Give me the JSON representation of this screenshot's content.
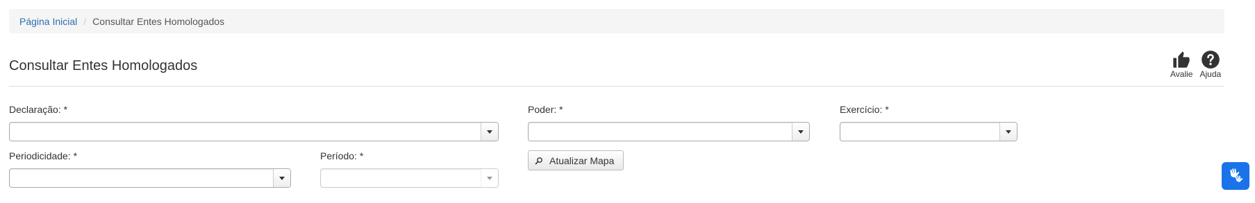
{
  "breadcrumb": {
    "home": "Página Inicial",
    "current": "Consultar Entes Homologados"
  },
  "page": {
    "title": "Consultar Entes Homologados"
  },
  "actions": {
    "rate": "Avalie",
    "help": "Ajuda"
  },
  "form": {
    "declaracao": {
      "label": "Declaração: *",
      "value": ""
    },
    "poder": {
      "label": "Poder: *",
      "value": ""
    },
    "exercicio": {
      "label": "Exercício: *",
      "value": ""
    },
    "periodicidade": {
      "label": "Periodicidade: *",
      "value": ""
    },
    "periodo": {
      "label": "Período: *",
      "value": ""
    },
    "submit_label": "Atualizar Mapa"
  },
  "icons": [
    "thumbs-up-icon",
    "help-icon",
    "search-icon",
    "sign-language-icon"
  ],
  "colors": {
    "link": "#2a6fb0",
    "accessibility_button": "#1a73e8"
  }
}
